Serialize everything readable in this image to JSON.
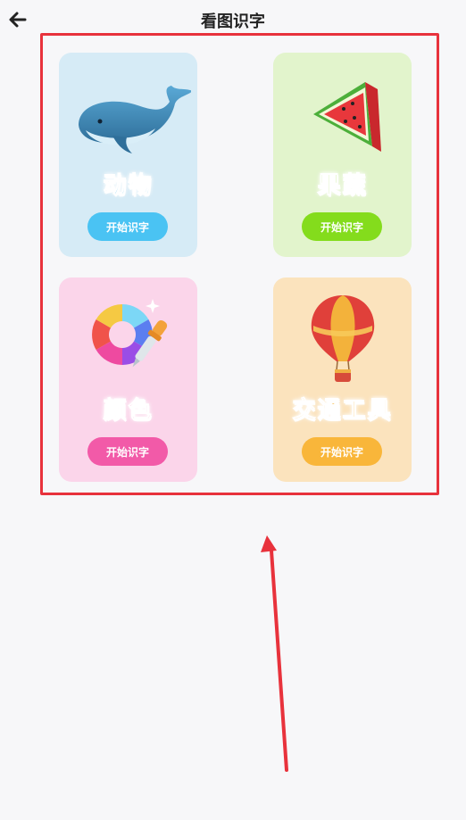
{
  "header": {
    "title": "看图识字",
    "back_icon": "arrow-left-icon"
  },
  "cards": [
    {
      "label": "动物",
      "button": "开始识字",
      "icon": "whale-icon",
      "color": "#3fb4ec"
    },
    {
      "label": "果蔬",
      "button": "开始识字",
      "icon": "watermelon-icon",
      "color": "#84d412"
    },
    {
      "label": "颜色",
      "button": "开始识字",
      "icon": "color-wheel-icon",
      "color": "#ef4a9b"
    },
    {
      "label": "交通工具",
      "button": "开始识字",
      "icon": "hot-air-balloon-icon",
      "color": "#f6b43a"
    }
  ],
  "annotation": {
    "highlight_color": "#e8323c"
  }
}
